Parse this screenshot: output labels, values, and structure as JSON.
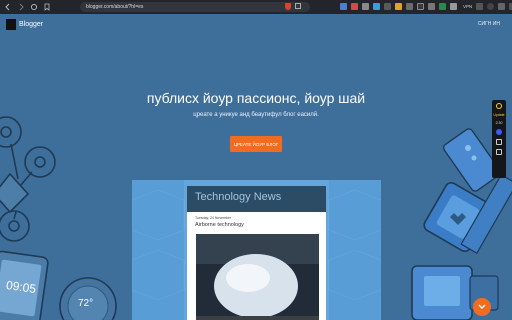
{
  "browser": {
    "url": "blogger.com/about/?hl=es",
    "vpn_label": "VPN"
  },
  "header": {
    "logo_text": "Blogger",
    "signin_label": "СИГН ИН"
  },
  "hero": {
    "title": "публисх йоур пассионс, йоур шай",
    "subtitle": "цреате а уникуе анд беаутифул блог еасилй.",
    "cta_label": "ЦРЕАТЕ ЙОУР БЛОГ"
  },
  "preview": {
    "blog_title": "Technology News",
    "post_date": "Tuesday, 24 November",
    "post_title": "Airborne technology"
  },
  "decor": {
    "watch_time": "09:05",
    "thermostat_temp": "72°"
  },
  "side_widget": {
    "update_label": "Update",
    "time_label": "2:30"
  },
  "colors": {
    "page_bg": "#3e6e9a",
    "accent": "#f26c1f",
    "card_panel": "#4b93d2"
  }
}
